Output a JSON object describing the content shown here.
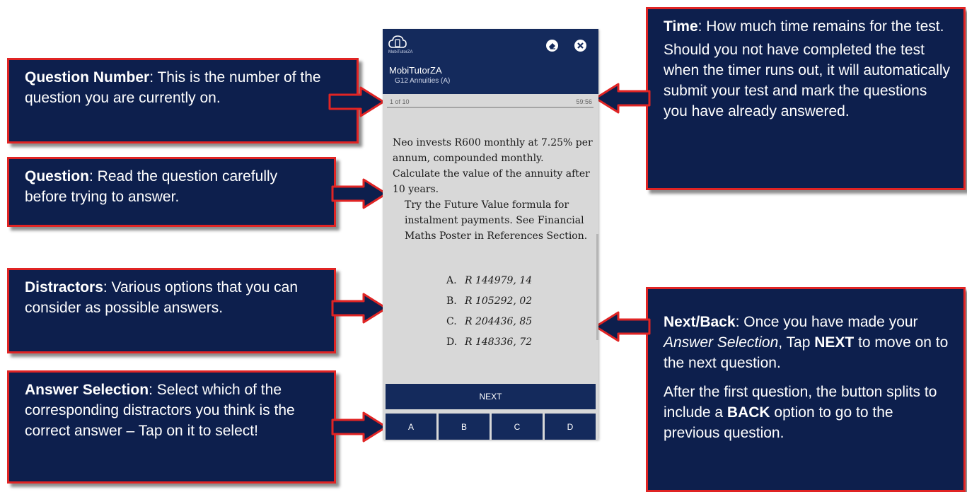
{
  "annotations": {
    "question_number": {
      "title": "Question Number",
      "text": ":  This is the number of the question you are currently on."
    },
    "question": {
      "title": "Question",
      "text": ":  Read the question carefully before trying to answer."
    },
    "distractors": {
      "title": "Distractors",
      "text": ":  Various options that you can consider as possible answers."
    },
    "answer_selection": {
      "title": "Answer Selection",
      "text": ":  Select which of the corresponding distractors you think is the correct answer – Tap on it to select!"
    },
    "time": {
      "title": "Time",
      "text": ":  How much time remains for the test.",
      "text2": "Should you not have completed the test when the timer runs out, it will automatically submit your test and mark the questions you have already answered."
    },
    "next_back": {
      "title": "Next/Back",
      "text_a": ":  Once you have made your ",
      "text_italic": "Answer Selection",
      "text_b": ", Tap ",
      "text_bold": "NEXT",
      "text_c": " to move on to the next question.",
      "text2_a": "After the first question, the button splits to include a ",
      "text2_bold": "BACK",
      "text2_b": " option to go to the previous question."
    }
  },
  "app": {
    "logo_text": "MobiTutorZA",
    "name": "MobiTutorZA",
    "test_name": "G12 Annuities (A)",
    "progress": "1 of 10",
    "timer": "59:56",
    "question": "Neo invests R600 monthly at 7.25% per annum, compounded monthly. Calculate the value of the annuity after 10 years.",
    "hint": "Try the Future Value formula for instalment payments. See Financial Maths Poster in References Section.",
    "options": [
      {
        "letter": "A.",
        "value": "R 144979, 14"
      },
      {
        "letter": "B.",
        "value": "R 105292, 02"
      },
      {
        "letter": "C.",
        "value": "R 204436, 85"
      },
      {
        "letter": "D.",
        "value": "R 148336, 72"
      }
    ],
    "next_label": "NEXT",
    "answer_buttons": [
      "A",
      "B",
      "C",
      "D"
    ]
  },
  "icons": {
    "logo": "cloud-phone-logo-icon",
    "eraser": "eraser-icon",
    "close": "close-icon"
  },
  "colors": {
    "box_bg": "#0d1f4d",
    "box_border": "#e02424",
    "app_header": "#142a5c",
    "phone_bg": "#d8d8d8"
  }
}
